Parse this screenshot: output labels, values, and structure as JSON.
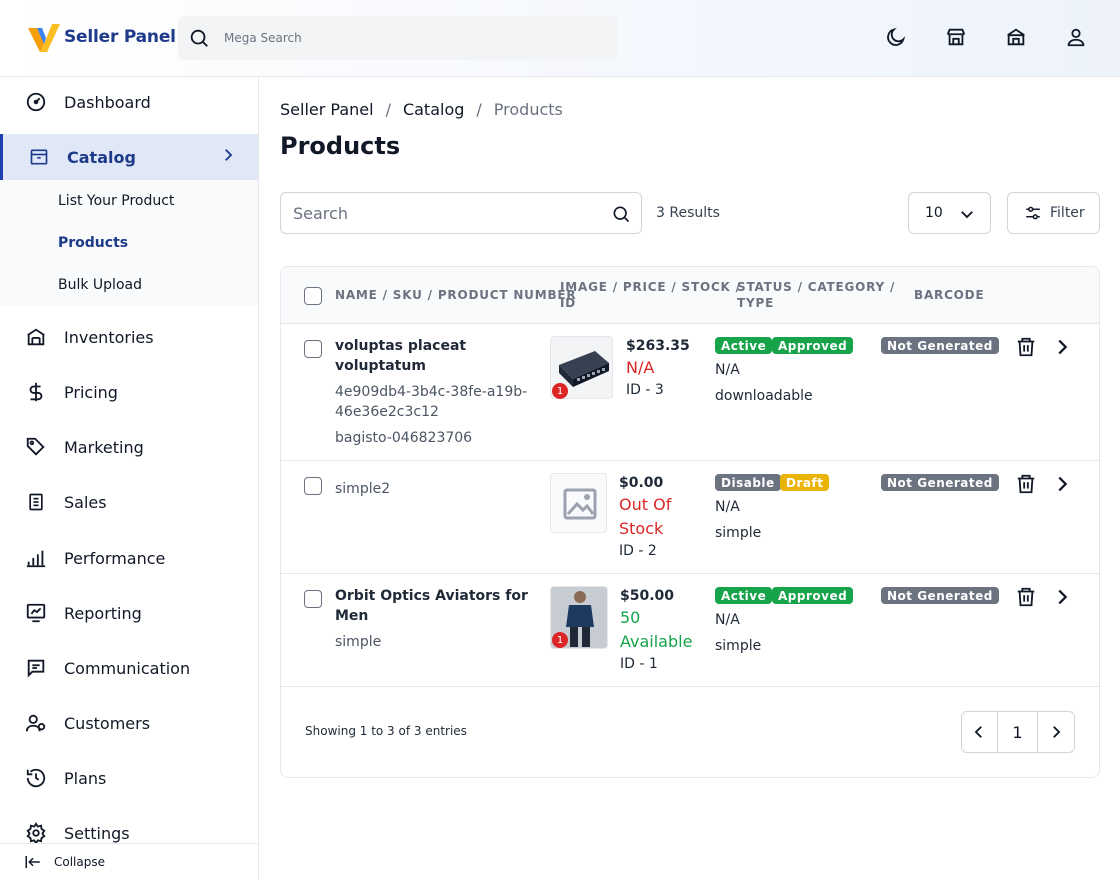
{
  "header": {
    "logo_text": "Seller Panel",
    "search_placeholder": "Mega Search",
    "icons": [
      "moon-icon",
      "store-icon",
      "shop-icon",
      "user-icon"
    ]
  },
  "sidebar": {
    "items": [
      {
        "label": "Dashboard",
        "icon": "dashboard-icon"
      },
      {
        "label": "Catalog",
        "icon": "catalog-icon",
        "active": true
      },
      {
        "label": "Inventories",
        "icon": "warehouse-icon"
      },
      {
        "label": "Pricing",
        "icon": "dollar-icon"
      },
      {
        "label": "Marketing",
        "icon": "tag-icon"
      },
      {
        "label": "Sales",
        "icon": "receipt-icon"
      },
      {
        "label": "Performance",
        "icon": "bar-chart-icon"
      },
      {
        "label": "Reporting",
        "icon": "report-icon"
      },
      {
        "label": "Communication",
        "icon": "message-icon"
      },
      {
        "label": "Customers",
        "icon": "customers-icon"
      },
      {
        "label": "Plans",
        "icon": "history-icon"
      },
      {
        "label": "Settings",
        "icon": "gear-icon"
      }
    ],
    "subitems": [
      "List Your Product",
      "Products",
      "Bulk Upload"
    ],
    "collapse_label": "Collapse"
  },
  "breadcrumb": {
    "root": "Seller Panel",
    "section": "Catalog",
    "current": "Products",
    "sep": "/"
  },
  "page_title": "Products",
  "toolbar": {
    "search_placeholder": "Search",
    "results": "3 Results",
    "per_page": "10",
    "filter_label": "Filter"
  },
  "table": {
    "headers": {
      "name_l1": "NAME / SKU / PRODUCT NUMBER",
      "img_l1": "IMAGE / PRICE / STOCK /",
      "img_l2": "ID",
      "status_l1": "STATUS / CATEGORY /",
      "status_l2": "TYPE",
      "barcode": "BARCODE"
    },
    "rows": [
      {
        "name_l1": "voluptas placeat",
        "name_l2": "voluptatum",
        "sku_l1": "4e909db4-3b4c-38fe-a19b-",
        "sku_l2": "46e36e2c3c12",
        "product_number": "bagisto-046823706",
        "image_count": "1",
        "price": "$263.35",
        "stock": "N/A",
        "id": "ID - 3",
        "status": "Active",
        "approval": "Approved",
        "category": "N/A",
        "type": "downloadable",
        "barcode": "Not Generated"
      },
      {
        "name": "simple2",
        "price": "$0.00",
        "stock_l1": "Out Of",
        "stock_l2": "Stock",
        "id": "ID - 2",
        "status": "Disable",
        "approval": "Draft",
        "category": "N/A",
        "type": "simple",
        "barcode": "Not Generated"
      },
      {
        "name_l1": "Orbit Optics Aviators for",
        "name_l2": "Men",
        "sku": "simple",
        "image_count": "1",
        "price": "$50.00",
        "stock_l1": "50",
        "stock_l2": "Available",
        "id": "ID - 1",
        "status": "Active",
        "approval": "Approved",
        "category": "N/A",
        "type": "simple",
        "barcode": "Not Generated"
      }
    ]
  },
  "pagination": {
    "showing": "Showing 1 to 3 of 3 entries",
    "page": "1"
  },
  "colors": {
    "brand": "#1e3a8a",
    "accent": "#1e40af",
    "active_bg": "#e0e8f8",
    "green": "#16a34a",
    "red": "#dc2626",
    "amber": "#eab308",
    "grey": "#6b7280"
  }
}
